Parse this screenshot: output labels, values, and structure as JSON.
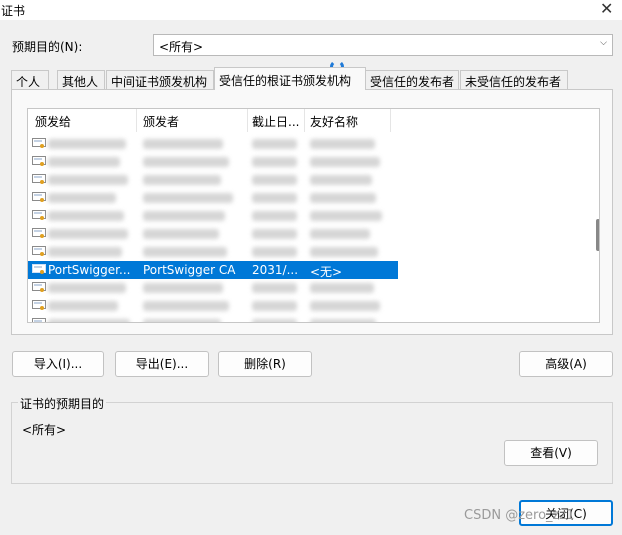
{
  "window": {
    "title": "证书",
    "close_glyph": "✕"
  },
  "purpose": {
    "label": "预期目的(N):",
    "value": "<所有>",
    "arrow": "⌵"
  },
  "tabs": [
    {
      "label": "个人"
    },
    {
      "label": "其他人"
    },
    {
      "label": "中间证书颁发机构"
    },
    {
      "label": "受信任的根证书颁发机构",
      "active": true
    },
    {
      "label": "受信任的发布者"
    },
    {
      "label": "未受信任的发布者"
    }
  ],
  "list": {
    "columns": [
      "颁发给",
      "颁发者",
      "截止日...",
      "友好名称"
    ],
    "selected_row": {
      "issued_to": "PortSwigger...",
      "issued_by": "PortSwigger CA",
      "expiry": "2031/...",
      "friendly_name": "<无>"
    }
  },
  "buttons": {
    "import": "导入(I)...",
    "export": "导出(E)...",
    "delete": "删除(R)",
    "advanced": "高级(A)",
    "view": "查看(V)",
    "close": "关闭(C)"
  },
  "purpose_group": {
    "label": "证书的预期目的",
    "value": "<所有>"
  },
  "watermark": "CSDN @zero_zz1",
  "colors": {
    "selection": "#0078d7",
    "accent": "#1f7ad8"
  }
}
